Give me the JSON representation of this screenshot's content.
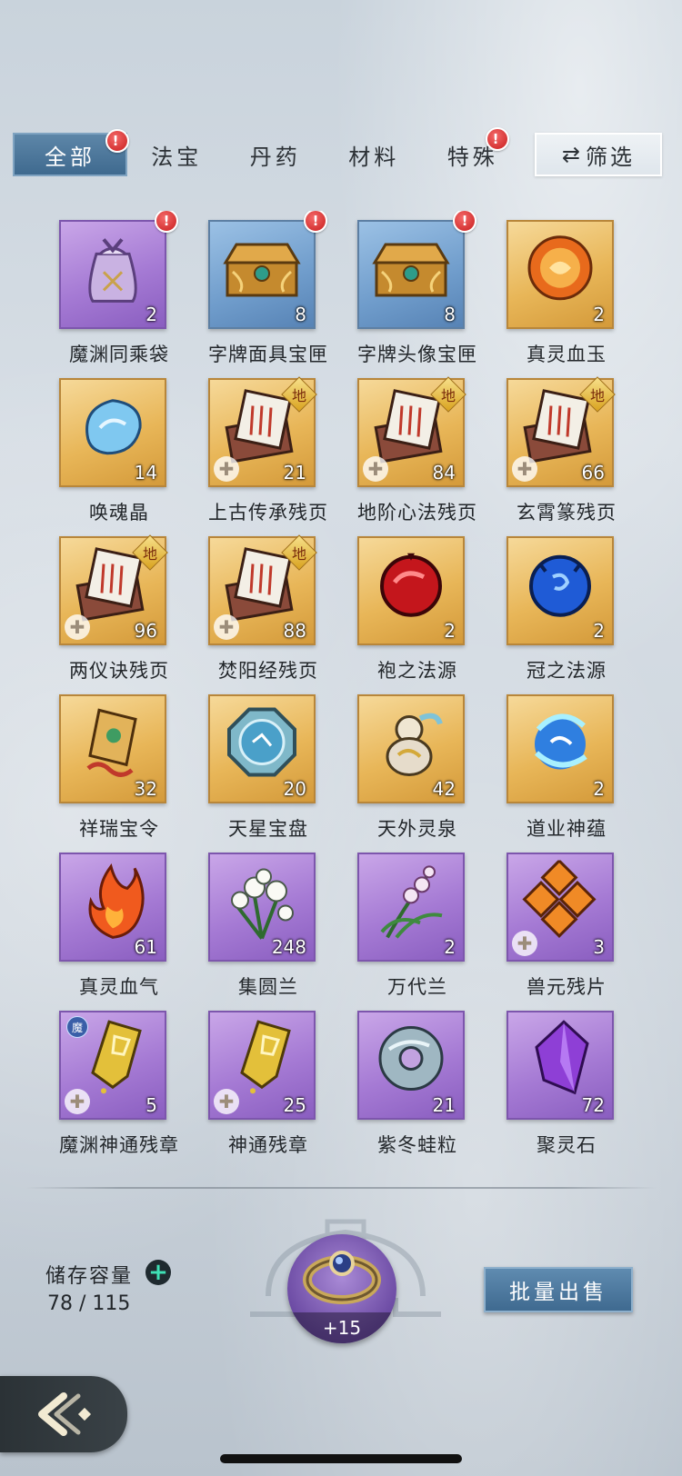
{
  "tabs": [
    {
      "label": "全部",
      "badge": "!"
    },
    {
      "label": "法宝",
      "badge": ""
    },
    {
      "label": "丹药",
      "badge": ""
    },
    {
      "label": "材料",
      "badge": ""
    },
    {
      "label": "特殊",
      "badge": "!"
    }
  ],
  "filter": {
    "label": "筛选",
    "icon": "swap-arrows-icon"
  },
  "items": [
    {
      "name": "魔渊同乘袋",
      "count": "2",
      "rarity": "purple",
      "icon": "pouch-icon",
      "badge": "!"
    },
    {
      "name": "字牌面具宝匣",
      "count": "8",
      "rarity": "blue",
      "icon": "chest-icon",
      "badge": "!"
    },
    {
      "name": "字牌头像宝匣",
      "count": "8",
      "rarity": "blue",
      "icon": "chest-icon",
      "badge": "!"
    },
    {
      "name": "真灵血玉",
      "count": "2",
      "rarity": "gold",
      "icon": "orange-jade-icon"
    },
    {
      "name": "唤魂晶",
      "count": "14",
      "rarity": "gold",
      "icon": "blue-crystal-icon"
    },
    {
      "name": "上古传承残页",
      "count": "21",
      "rarity": "gold",
      "icon": "scroll-page-icon",
      "grade": "地",
      "fragment": true
    },
    {
      "name": "地阶心法残页",
      "count": "84",
      "rarity": "gold",
      "icon": "scroll-page-icon",
      "grade": "地",
      "fragment": true
    },
    {
      "name": "玄霄篆残页",
      "count": "66",
      "rarity": "gold",
      "icon": "scroll-page-icon",
      "grade": "地",
      "fragment": true
    },
    {
      "name": "两仪诀残页",
      "count": "96",
      "rarity": "gold",
      "icon": "scroll-page-icon",
      "grade": "地",
      "fragment": true
    },
    {
      "name": "焚阳经残页",
      "count": "88",
      "rarity": "gold",
      "icon": "scroll-page-icon",
      "grade": "地",
      "fragment": true
    },
    {
      "name": "袍之法源",
      "count": "2",
      "rarity": "gold",
      "icon": "red-orb-icon"
    },
    {
      "name": "冠之法源",
      "count": "2",
      "rarity": "gold",
      "icon": "blue-orb-icon"
    },
    {
      "name": "祥瑞宝令",
      "count": "32",
      "rarity": "gold",
      "icon": "token-icon"
    },
    {
      "name": "天星宝盘",
      "count": "20",
      "rarity": "gold",
      "icon": "star-disc-icon"
    },
    {
      "name": "天外灵泉",
      "count": "42",
      "rarity": "gold",
      "icon": "gourd-icon"
    },
    {
      "name": "道业神蕴",
      "count": "2",
      "rarity": "gold",
      "icon": "spirit-swirl-icon"
    },
    {
      "name": "真灵血气",
      "count": "61",
      "rarity": "purple",
      "icon": "flame-icon"
    },
    {
      "name": "集圆兰",
      "count": "248",
      "rarity": "purple",
      "icon": "white-orchid-icon"
    },
    {
      "name": "万代兰",
      "count": "2",
      "rarity": "purple",
      "icon": "orchid-sprig-icon"
    },
    {
      "name": "兽元残片",
      "count": "3",
      "rarity": "purple",
      "icon": "beast-shards-icon",
      "fragment": true
    },
    {
      "name": "魔渊神通残章",
      "count": "5",
      "rarity": "purple",
      "icon": "gold-fragment-icon",
      "fragment": true,
      "tag": "魔"
    },
    {
      "name": "神通残章",
      "count": "25",
      "rarity": "purple",
      "icon": "gold-fragment-icon",
      "fragment": true
    },
    {
      "name": "紫冬蛙粒",
      "count": "21",
      "rarity": "purple",
      "icon": "jade-ring-icon"
    },
    {
      "name": "聚灵石",
      "count": "72",
      "rarity": "purple",
      "icon": "purple-crystal-icon"
    }
  ],
  "storage": {
    "label": "储存容量",
    "value": "78 / 115"
  },
  "equipped": {
    "plus": "+15",
    "icon": "ring-icon"
  },
  "sell": {
    "label": "批量出售"
  },
  "colors": {
    "tab_active": "#4a7598",
    "gold": "#e8b658",
    "blue": "#6f9ccb",
    "purple": "#a57ad4",
    "badge": "#d62828"
  }
}
